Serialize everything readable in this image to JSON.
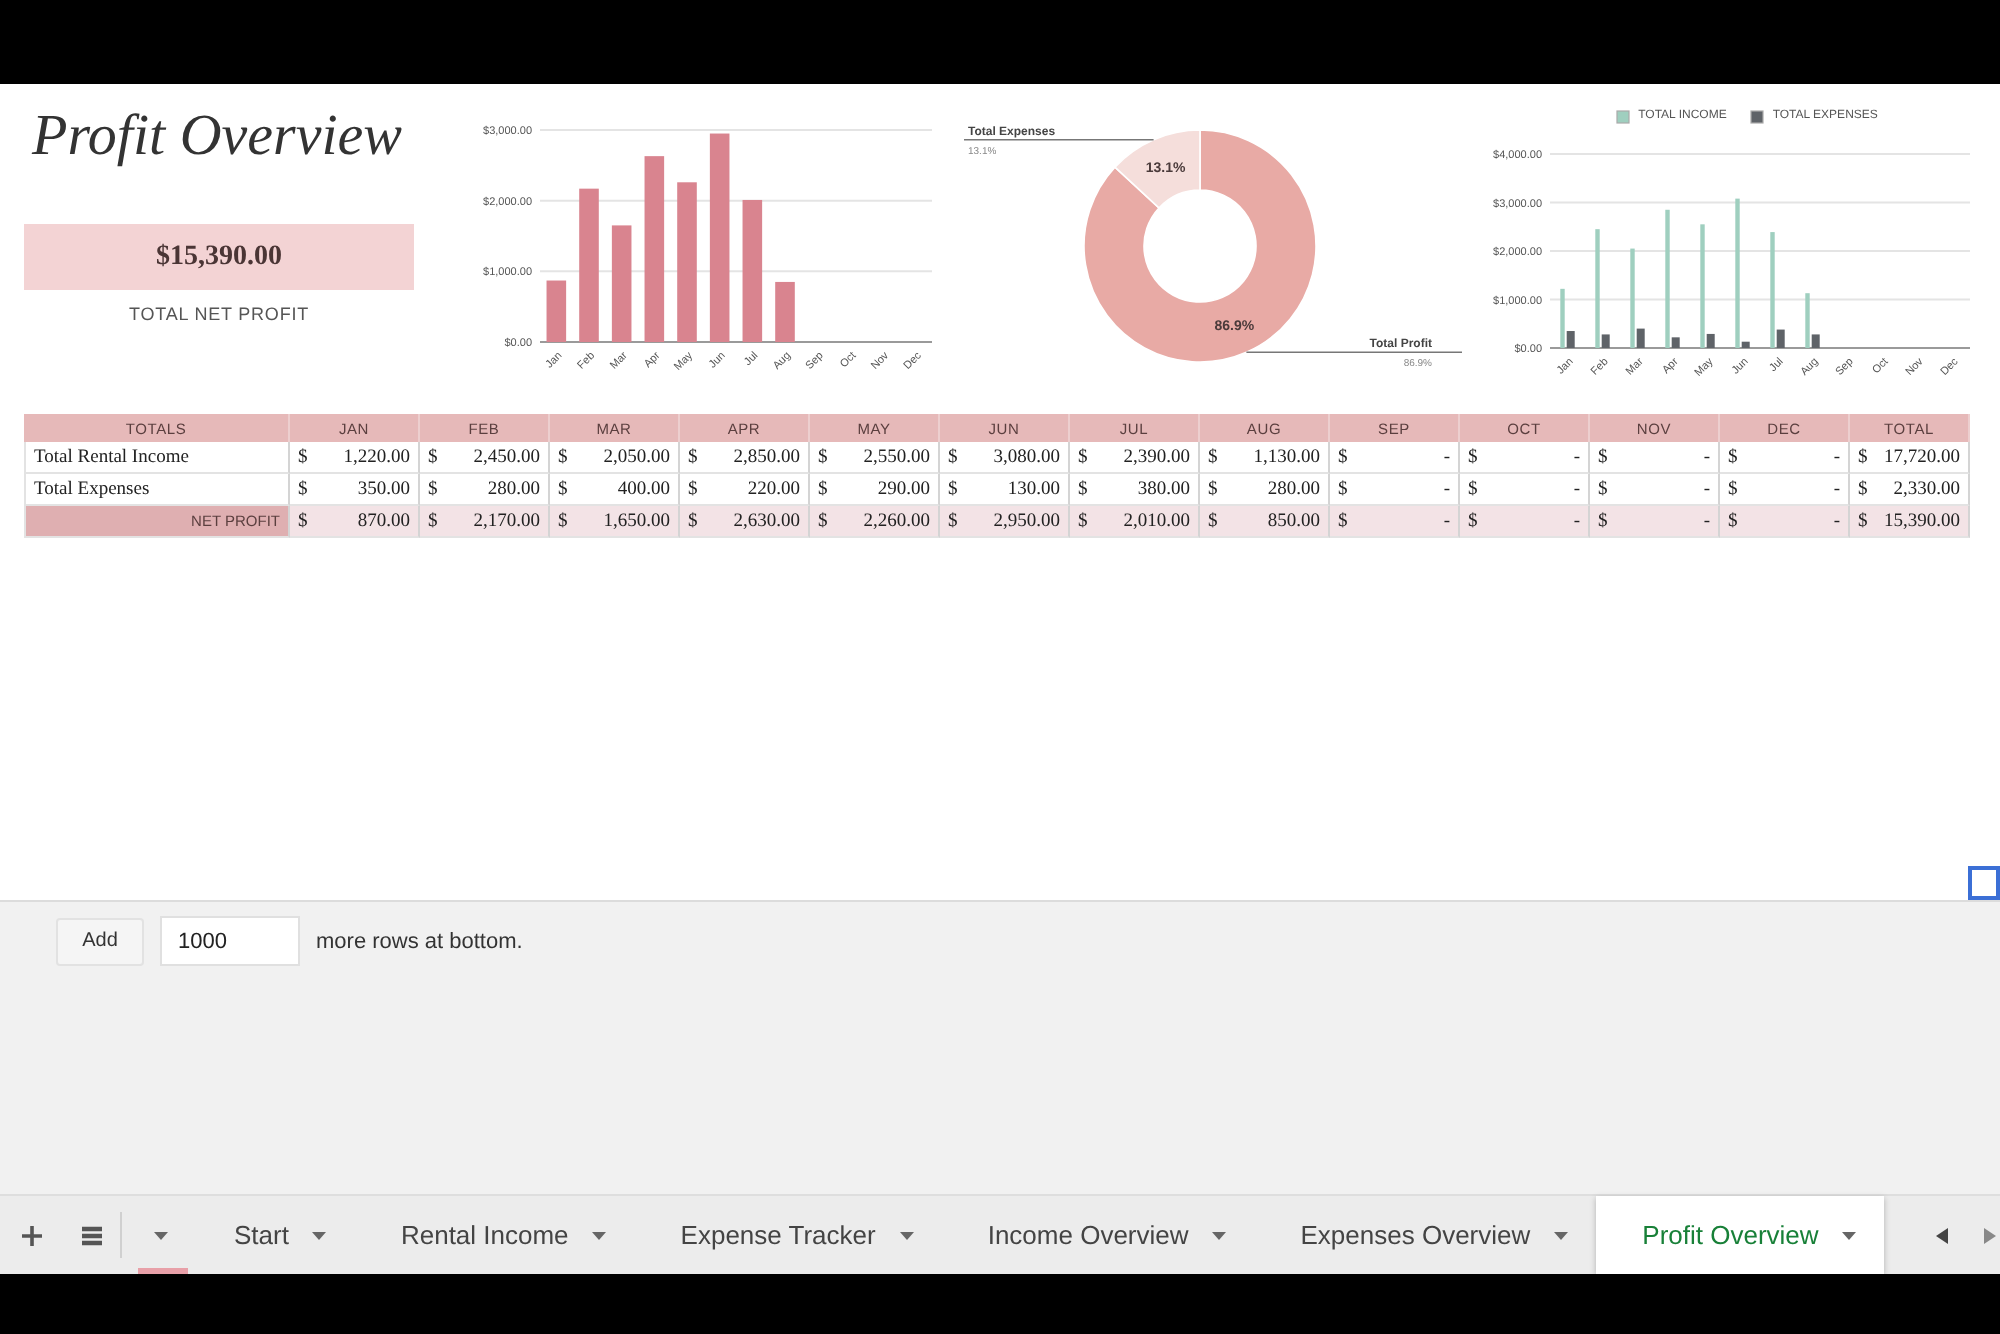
{
  "summary": {
    "title": "Profit Overview",
    "net_profit": "$15,390.00",
    "net_profit_label": "TOTAL NET PROFIT"
  },
  "net_profit_chart": {
    "chart_data": [
      {
        "type": "bar",
        "categories": [
          "Jan",
          "Feb",
          "Mar",
          "Apr",
          "May",
          "Jun",
          "Jul",
          "Aug",
          "Sep",
          "Oct",
          "Nov",
          "Dec"
        ],
        "values": [
          870,
          2170,
          1650,
          2630,
          2260,
          2950,
          2010,
          850,
          0,
          0,
          0,
          0
        ],
        "color": "#d9848f",
        "ylim": [
          0,
          3000
        ],
        "yticks": [
          {
            "value": 0,
            "label": "$0.00"
          },
          {
            "value": 1000,
            "label": "$1,000.00"
          },
          {
            "value": 2000,
            "label": "$2,000.00"
          },
          {
            "value": 3000,
            "label": "$3,000.00"
          }
        ],
        "grid": true
      }
    ]
  },
  "profit_split_chart": {
    "chart_data": [
      {
        "type": "donut",
        "categories": [
          "Total Profit",
          "Total Expenses"
        ],
        "values": [
          86.9,
          13.1
        ],
        "colors": [
          "#e8aaa5",
          "#f5dedb"
        ],
        "value_labels": [
          "86.9%",
          "13.1%"
        ]
      }
    ],
    "callout_values": [
      "86.9%",
      "13.1%"
    ]
  },
  "income_expenses_chart": {
    "chart_data": [
      {
        "type": "bar",
        "categories": [
          "Jan",
          "Feb",
          "Mar",
          "Apr",
          "May",
          "Jun",
          "Jul",
          "Aug",
          "Sep",
          "Oct",
          "Nov",
          "Dec"
        ],
        "series": [
          {
            "name": "TOTAL INCOME",
            "color": "#9fcfbf",
            "values": [
              1220,
              2450,
              2050,
              2850,
              2550,
              3080,
              2390,
              1130,
              0,
              0,
              0,
              0
            ]
          },
          {
            "name": "TOTAL EXPENSES",
            "color": "#5f6368",
            "values": [
              350,
              280,
              400,
              220,
              290,
              130,
              380,
              280,
              0,
              0,
              0,
              0
            ]
          }
        ],
        "ylim": [
          0,
          4000
        ],
        "yticks": [
          {
            "value": 0,
            "label": "$0.00"
          },
          {
            "value": 1000,
            "label": "$1,000.00"
          },
          {
            "value": 2000,
            "label": "$2,000.00"
          },
          {
            "value": 3000,
            "label": "$3,000.00"
          },
          {
            "value": 4000,
            "label": "$4,000.00"
          }
        ],
        "legend": "top",
        "grid": true
      }
    ]
  },
  "table": {
    "columns": [
      "TOTALS",
      "JAN",
      "FEB",
      "MAR",
      "APR",
      "MAY",
      "JUN",
      "JUL",
      "AUG",
      "SEP",
      "OCT",
      "NOV",
      "DEC",
      "TOTAL"
    ],
    "rows": [
      {
        "kind": "data",
        "cells": [
          [
            "Total Rental Income"
          ],
          [
            "$",
            "1,220.00"
          ],
          [
            "$",
            "2,450.00"
          ],
          [
            "$",
            "2,050.00"
          ],
          [
            "$",
            "2,850.00"
          ],
          [
            "$",
            "2,550.00"
          ],
          [
            "$",
            "3,080.00"
          ],
          [
            "$",
            "2,390.00"
          ],
          [
            "$",
            "1,130.00"
          ],
          [
            "$",
            "-"
          ],
          [
            "$",
            "-"
          ],
          [
            "$",
            "-"
          ],
          [
            "$",
            "-"
          ],
          [
            "$",
            "17,720.00"
          ]
        ]
      },
      {
        "kind": "data",
        "cells": [
          [
            "Total Expenses"
          ],
          [
            "$",
            "350.00"
          ],
          [
            "$",
            "280.00"
          ],
          [
            "$",
            "400.00"
          ],
          [
            "$",
            "220.00"
          ],
          [
            "$",
            "290.00"
          ],
          [
            "$",
            "130.00"
          ],
          [
            "$",
            "380.00"
          ],
          [
            "$",
            "280.00"
          ],
          [
            "$",
            "-"
          ],
          [
            "$",
            "-"
          ],
          [
            "$",
            "-"
          ],
          [
            "$",
            "-"
          ],
          [
            "$",
            "2,330.00"
          ]
        ]
      },
      {
        "kind": "total",
        "cells": [
          [
            "NET PROFIT"
          ],
          [
            "$",
            "870.00"
          ],
          [
            "$",
            "2,170.00"
          ],
          [
            "$",
            "1,650.00"
          ],
          [
            "$",
            "2,630.00"
          ],
          [
            "$",
            "2,260.00"
          ],
          [
            "$",
            "2,950.00"
          ],
          [
            "$",
            "2,010.00"
          ],
          [
            "$",
            "850.00"
          ],
          [
            "$",
            "-"
          ],
          [
            "$",
            "-"
          ],
          [
            "$",
            "-"
          ],
          [
            "$",
            "-"
          ],
          [
            "$",
            "15,390.00"
          ]
        ]
      }
    ]
  },
  "add_rows": {
    "button": "Add",
    "value": "1000",
    "text": "more rows at bottom."
  },
  "sheet_tabs": [
    {
      "kind": "partial",
      "color": "#e8a0a8",
      "selected": false
    },
    {
      "kind": "tab",
      "label": "Start",
      "selected": false
    },
    {
      "kind": "tab",
      "label": "Rental Income",
      "selected": false
    },
    {
      "kind": "tab",
      "label": "Expense Tracker",
      "selected": false
    },
    {
      "kind": "tab",
      "label": "Income Overview",
      "selected": false
    },
    {
      "kind": "tab",
      "label": "Expenses Overview",
      "selected": false
    },
    {
      "kind": "tab",
      "label": "Profit Overview",
      "selected": true
    }
  ]
}
